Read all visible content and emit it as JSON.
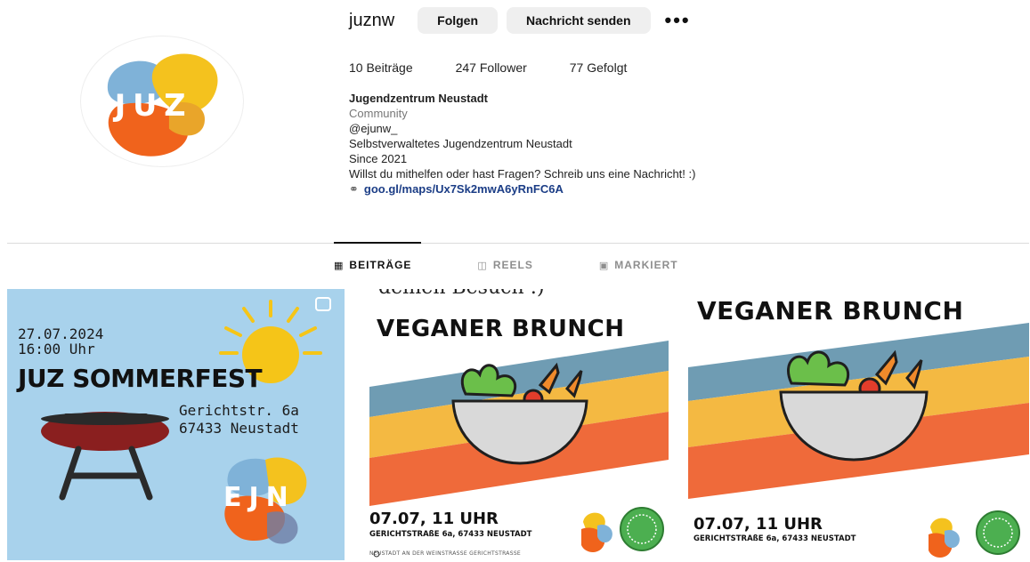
{
  "profile": {
    "username": "juznw",
    "follow_label": "Folgen",
    "message_label": "Nachricht senden",
    "more_label": "•••",
    "avatar_text": "JUZ"
  },
  "stats": {
    "posts": "10 Beiträge",
    "followers": "247 Follower",
    "following": "77 Gefolgt"
  },
  "bio": {
    "name": "Jugendzentrum Neustadt",
    "category": "Community",
    "handle": "@ejunw_",
    "line1": "Selbstverwaltetes Jugendzentrum Neustadt",
    "line2": "Since 2021",
    "line3": "Willst du mithelfen oder hast Fragen? Schreib uns eine Nachricht! :)",
    "link": "goo.gl/maps/Ux7Sk2mwA6yRnFC6A"
  },
  "tabs": [
    {
      "label": "BEITRÄGE",
      "icon": "grid-icon",
      "active": true
    },
    {
      "label": "REELS",
      "icon": "reels-icon",
      "active": false
    },
    {
      "label": "MARKIERT",
      "icon": "tagged-icon",
      "active": false
    }
  ],
  "posts": [
    {
      "date": "27.07.2024",
      "time": "16:00 Uhr",
      "title": "JUZ SOMMERFEST",
      "street": "Gerichtstr. 6a",
      "city": "67433 Neustadt",
      "logo": "EJN"
    },
    {
      "top_text": "deinen Besuch :)",
      "title": "VEGANER BRUNCH",
      "time": "07.07, 11 UHR",
      "address": "GERICHTSTRAßE 6a, 67433 NEUSTADT",
      "bottom_text": "NEUSTADT AN DER WEINSTRASSE GERICHTSTRASSE"
    },
    {
      "title": "VEGANER BRUNCH",
      "time": "07.07, 11 UHR",
      "address": "GERICHTSTRAßE 6a, 67433 NEUSTADT"
    }
  ],
  "colors": {
    "stripe_blue": "#6f9cb3",
    "stripe_yellow": "#f4b942",
    "stripe_orange": "#ef6a3a",
    "link": "#1b3d86",
    "post1_bg": "#a8d2ec"
  }
}
